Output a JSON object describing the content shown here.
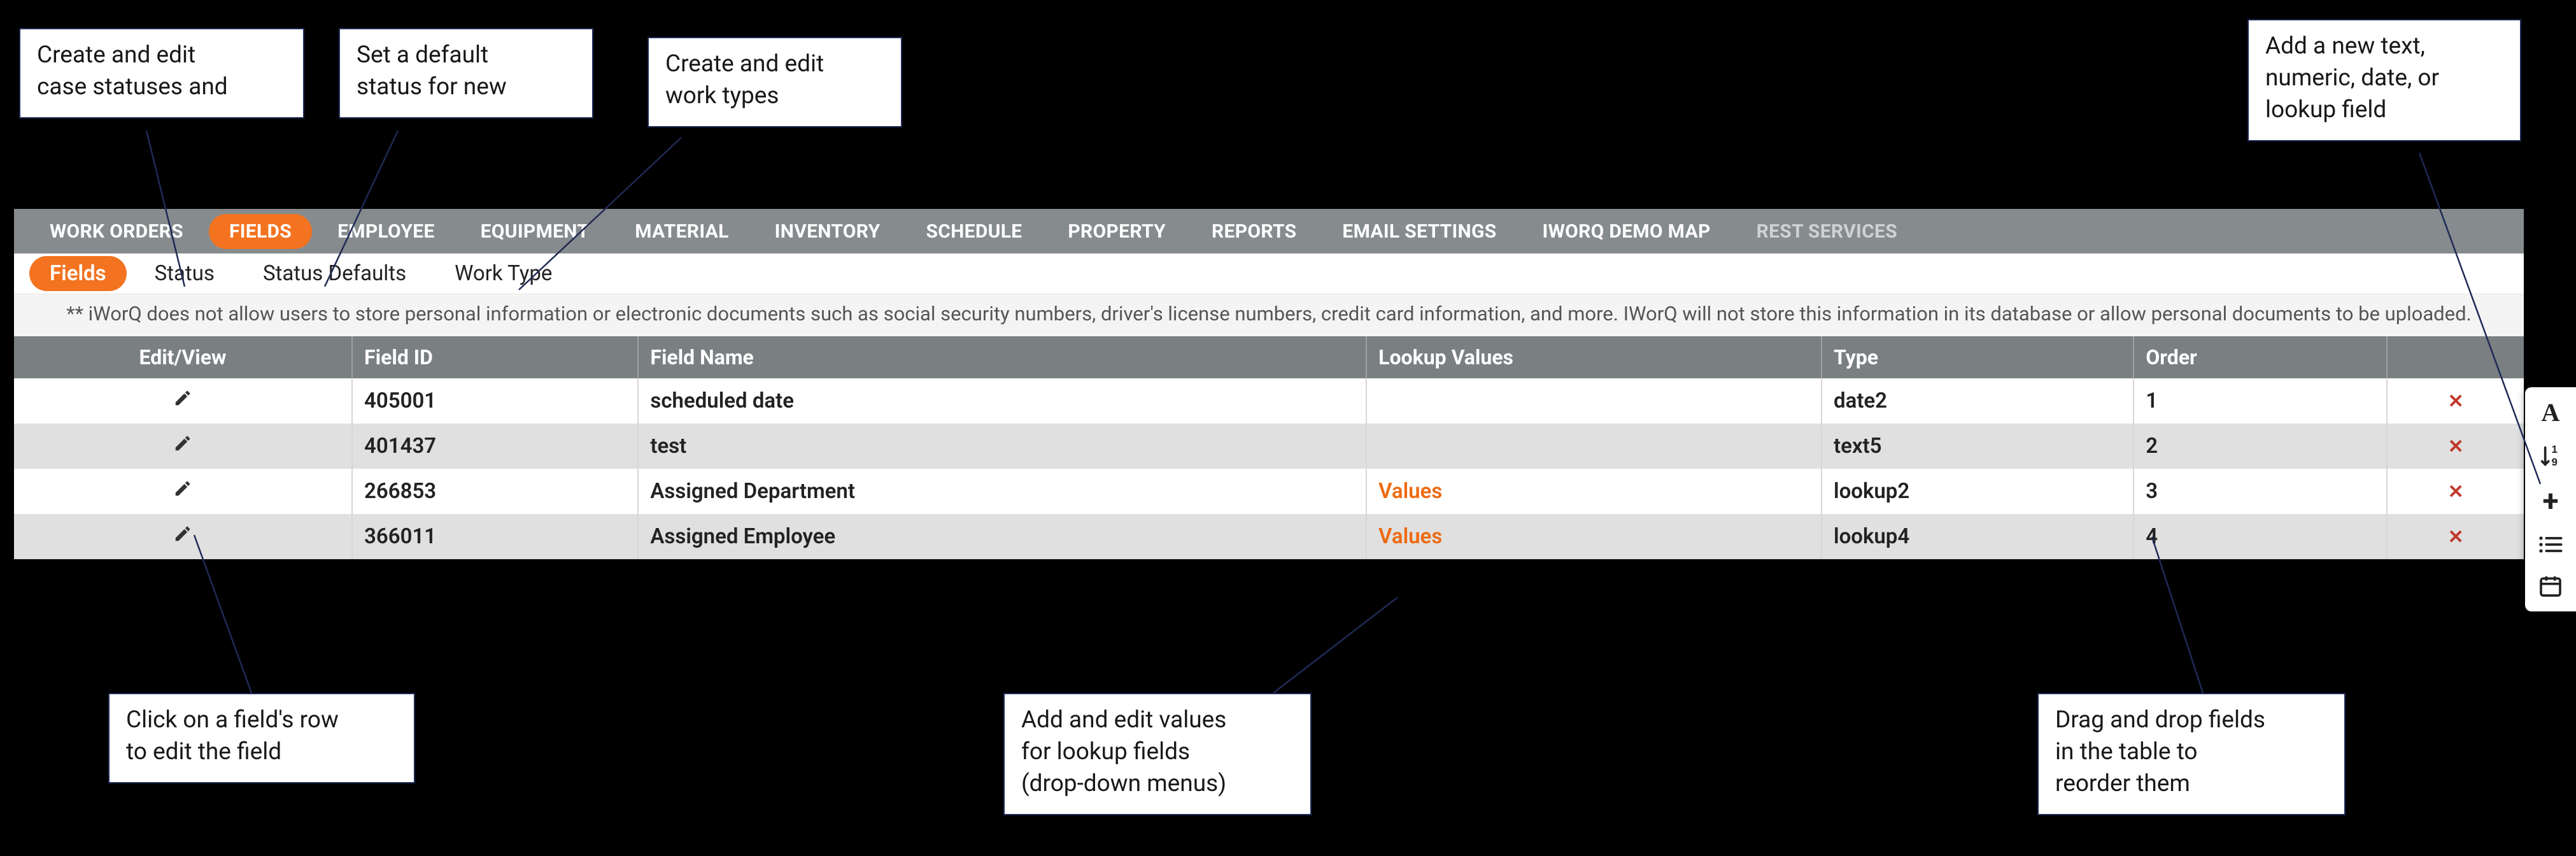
{
  "callouts": {
    "status": {
      "l1": "Create and edit",
      "l2": "case statuses and"
    },
    "defaults": {
      "l1": "Set a default",
      "l2": "status for new"
    },
    "worktype": {
      "l1": "Create and edit",
      "l2": "work types"
    },
    "addfield": {
      "l1": "Add a new text,",
      "l2": "numeric, date, or",
      "l3": "lookup field"
    },
    "rowedit": {
      "l1": "Click on a field's row",
      "l2": "to edit the field"
    },
    "lookupvals": {
      "l1": "Add and edit values",
      "l2": "for lookup fields",
      "l3": "(drop-down menus)"
    },
    "reorder": {
      "l1": "Drag and drop fields",
      "l2": "in the table to",
      "l3": "reorder them"
    }
  },
  "topnav": {
    "items": [
      {
        "label": "WORK ORDERS"
      },
      {
        "label": "FIELDS",
        "active": true
      },
      {
        "label": "EMPLOYEE"
      },
      {
        "label": "EQUIPMENT"
      },
      {
        "label": "MATERIAL"
      },
      {
        "label": "INVENTORY"
      },
      {
        "label": "SCHEDULE"
      },
      {
        "label": "PROPERTY"
      },
      {
        "label": "REPORTS"
      },
      {
        "label": "EMAIL SETTINGS"
      },
      {
        "label": "IWORQ DEMO MAP"
      },
      {
        "label": "REST SERVICES",
        "muted": true
      }
    ]
  },
  "subnav": {
    "items": [
      {
        "label": "Fields",
        "active": true
      },
      {
        "label": "Status"
      },
      {
        "label": "Status Defaults"
      },
      {
        "label": "Work Type"
      }
    ]
  },
  "disclaimer": "** iWorQ does not allow users to store personal information or electronic documents such as social security numbers, driver's license numbers, credit card information, and more. IWorQ will not store this information in its database or allow personal documents to be uploaded.",
  "table": {
    "headers": {
      "edit": "Edit/View",
      "id": "Field ID",
      "name": "Field Name",
      "lookup": "Lookup Values",
      "type": "Type",
      "order": "Order",
      "delete": ""
    },
    "rows": [
      {
        "id": "405001",
        "name": "scheduled date",
        "lookup": "",
        "type": "date2",
        "order": "1"
      },
      {
        "id": "401437",
        "name": "test",
        "lookup": "",
        "type": "text5",
        "order": "2"
      },
      {
        "id": "266853",
        "name": "Assigned Department",
        "lookup": "Values",
        "type": "lookup2",
        "order": "3"
      },
      {
        "id": "366011",
        "name": "Assigned Employee",
        "lookup": "Values",
        "type": "lookup4",
        "order": "4"
      }
    ],
    "lookup_link_text": "Values"
  },
  "toolrail": {
    "text_tool": "A",
    "numeric_tool": "↓",
    "add_tool": "+",
    "list_tool": "≔",
    "date_tool": "▭"
  }
}
